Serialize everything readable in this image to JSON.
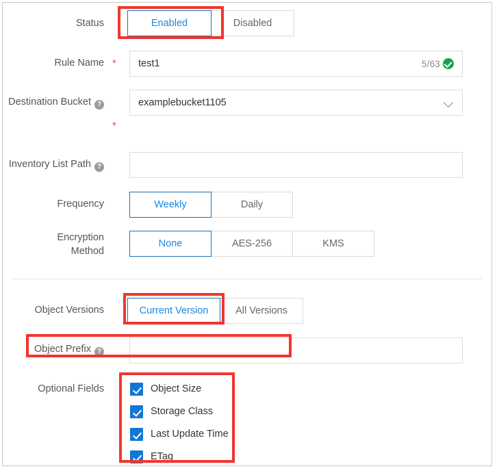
{
  "form": {
    "rows": [
      {
        "id": "status",
        "label": "Status",
        "type": "segmented",
        "options": [
          "Enabled",
          "Disabled"
        ],
        "selected": "Enabled",
        "highlighted": true
      },
      {
        "id": "rule-name",
        "label": "Rule Name",
        "type": "text",
        "required": true,
        "required_marker": "*",
        "value": "test1",
        "placeholder": "",
        "counter": "5/63",
        "valid_icon": "check-circle-icon"
      },
      {
        "id": "destination-bucket",
        "label": "Destination Bucket",
        "type": "select",
        "help_icon": "question-mark-icon",
        "value": "examplebucket1105",
        "required_marker": "*",
        "dropdown_icon": "chevron-down-icon"
      },
      {
        "id": "inventory-list-path",
        "label": "Inventory List Path",
        "type": "text",
        "help_icon": "question-mark-icon",
        "value": "",
        "placeholder": ""
      },
      {
        "id": "frequency",
        "label": "Frequency",
        "type": "segmented",
        "options": [
          "Weekly",
          "Daily"
        ],
        "selected": "Weekly"
      },
      {
        "id": "encryption-method",
        "label": "Encryption Method",
        "label_line1": "Encryption",
        "label_line2": "Method",
        "type": "segmented",
        "options": [
          "None",
          "AES-256",
          "KMS"
        ],
        "selected": "None"
      },
      {
        "id": "object-versions",
        "label": "Object Versions",
        "type": "segmented",
        "options": [
          "Current Version",
          "All Versions"
        ],
        "selected": "Current Version",
        "highlighted": true
      },
      {
        "id": "object-prefix",
        "label": "Object Prefix",
        "type": "text",
        "help_icon": "question-mark-icon",
        "value": "",
        "placeholder": "",
        "highlighted": true
      },
      {
        "id": "optional-fields",
        "label": "Optional Fields",
        "type": "checkbox-group",
        "highlighted": true,
        "items": [
          {
            "label": "Object Size",
            "checked": true
          },
          {
            "label": "Storage Class",
            "checked": true
          },
          {
            "label": "Last Update Time",
            "checked": true
          },
          {
            "label": "ETag",
            "checked": true
          }
        ]
      }
    ]
  },
  "colors": {
    "accent_blue": "#1a87e0",
    "active_border": "#1a6fb5",
    "annotation_red": "#f2352e",
    "checkbox_blue": "#1277d4",
    "valid_green": "#17a34a",
    "required_red": "#e8554d",
    "label_gray": "#555555",
    "border_gray": "#d9d9d9"
  }
}
